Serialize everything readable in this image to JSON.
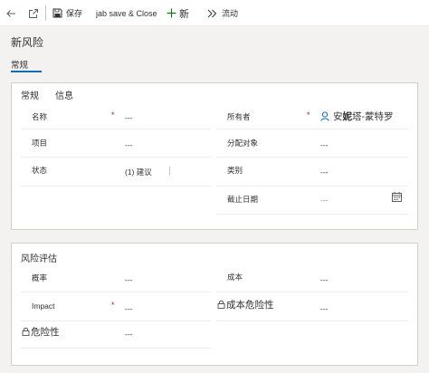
{
  "toolbar": {
    "save_label": "保存",
    "save_close_label": "jab save & Close",
    "new_label": "新",
    "flow_label": "流动"
  },
  "page": {
    "title": "新风险",
    "main_tab": "常规"
  },
  "general_card": {
    "subtabs": [
      "常规",
      "信息"
    ],
    "name": {
      "label": "名称",
      "required": "*",
      "value": "---"
    },
    "project": {
      "label": "项目",
      "value": "---"
    },
    "status": {
      "label": "状态",
      "value": "(1) 建议"
    },
    "owner": {
      "label": "所有者",
      "required": "*",
      "value_prefix": "安",
      "value_bold": "妮",
      "value_rest": "塔-蒙特罗"
    },
    "assigned_to": {
      "label": "分配对象",
      "value": "---"
    },
    "category": {
      "label": "类别",
      "value": "---"
    },
    "due_date": {
      "label": "截止日期",
      "value": "---"
    }
  },
  "risk_card": {
    "title": "风险评估",
    "probability": {
      "label": "概率",
      "value": "---"
    },
    "impact": {
      "label": "Impact",
      "required": "*",
      "value": "---"
    },
    "risk_score": {
      "label": "危险性",
      "value": "---"
    },
    "cost": {
      "label": "成本",
      "value": "---"
    },
    "cost_risk": {
      "label": "成本危险性",
      "value": "---"
    }
  },
  "colors": {
    "accent": "#0f6cbd",
    "required": "#a4262c",
    "new_icon": "#107c10"
  }
}
